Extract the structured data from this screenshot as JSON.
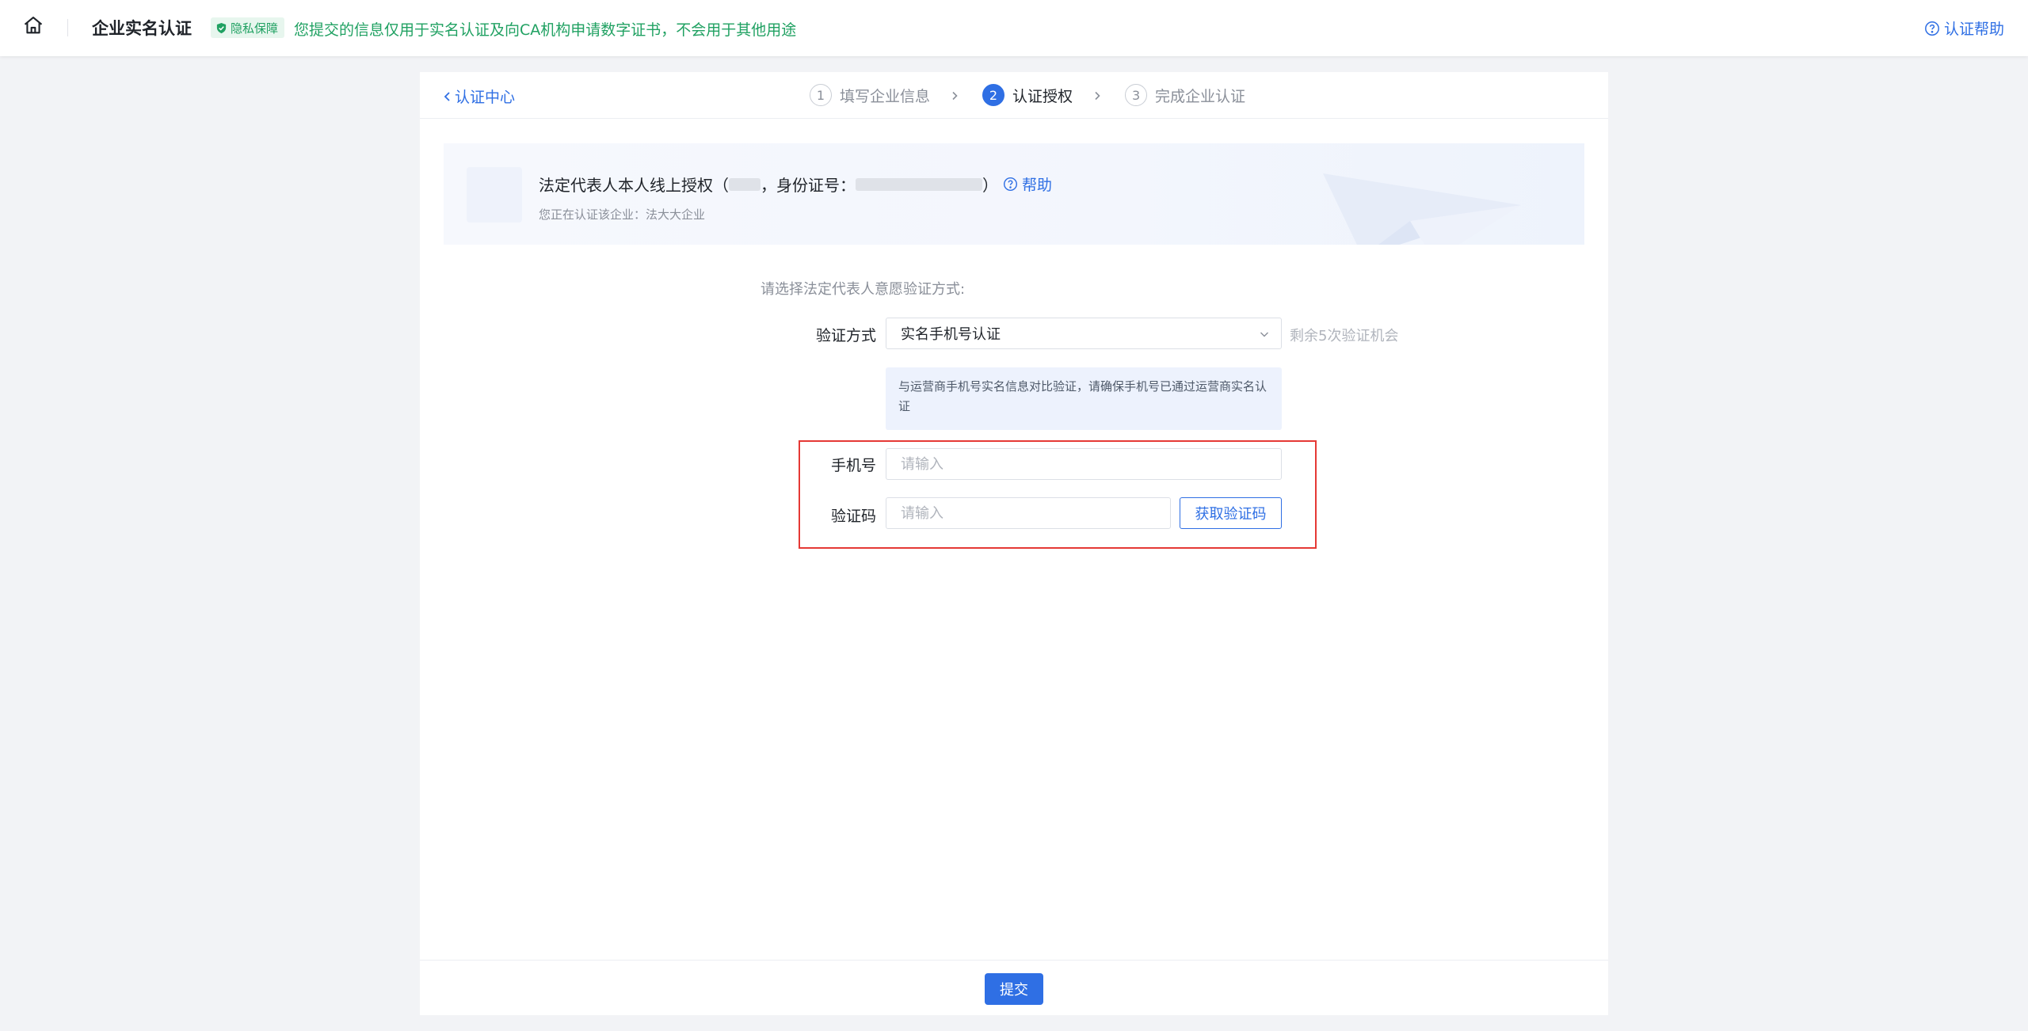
{
  "topbar": {
    "home_icon": "home-icon",
    "title": "企业实名认证",
    "privacy_badge": "隐私保障",
    "privacy_text": "您提交的信息仅用于实名认证及向CA机构申请数字证书，不会用于其他用途",
    "help_label": "认证帮助"
  },
  "header": {
    "back_label": "认证中心",
    "steps": [
      {
        "num": "1",
        "label": "填写企业信息",
        "active": false
      },
      {
        "num": "2",
        "label": "认证授权",
        "active": true
      },
      {
        "num": "3",
        "label": "完成企业认证",
        "active": false
      }
    ]
  },
  "banner": {
    "title_prefix": "法定代表人本人线上授权（",
    "id_label": "，身份证号：",
    "title_suffix": "）",
    "help_label": "帮助",
    "subtitle": "您正在认证该企业：法大大企业"
  },
  "form": {
    "hint": "请选择法定代表人意愿验证方式:",
    "method_label": "验证方式",
    "method_value": "实名手机号认证",
    "remaining": "剩余5次验证机会",
    "info": "与运营商手机号实名信息对比验证，请确保手机号已通过运营商实名认证",
    "phone_label": "手机号",
    "phone_placeholder": "请输入",
    "code_label": "验证码",
    "code_placeholder": "请输入",
    "code_button": "获取验证码"
  },
  "footer": {
    "submit_label": "提交"
  },
  "colors": {
    "primary": "#2f6fe4",
    "success": "#20a162",
    "highlight": "#e53935"
  }
}
